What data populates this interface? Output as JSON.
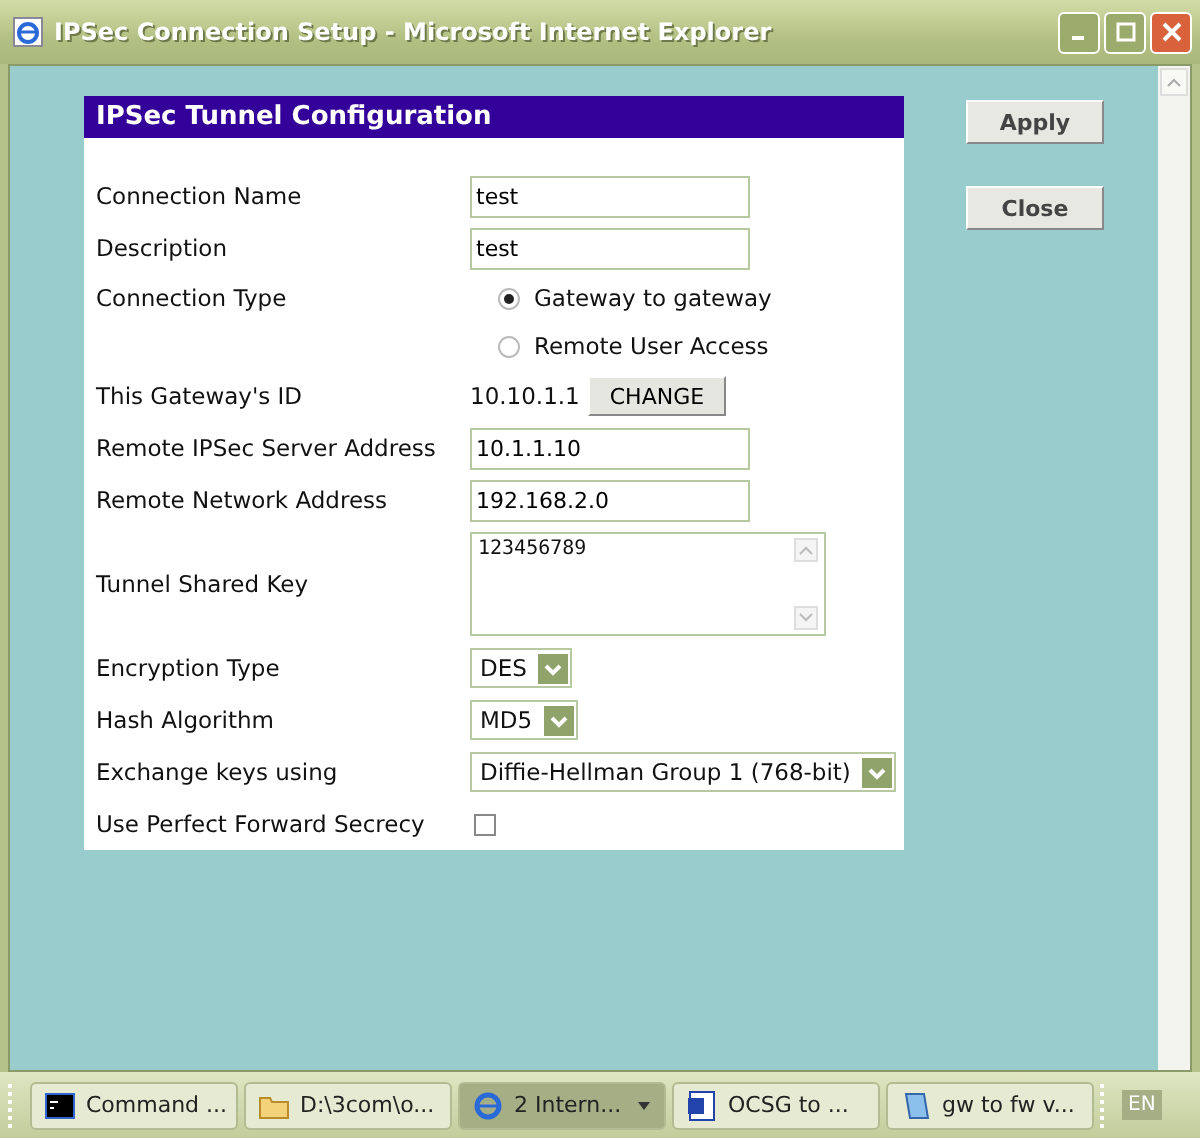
{
  "window": {
    "title": "IPSec Connection Setup - Microsoft Internet Explorer"
  },
  "panel": {
    "title": "IPSec Tunnel Configuration",
    "rows": [
      {
        "kind": "text",
        "label": "Connection Name",
        "value": "test"
      },
      {
        "kind": "text",
        "label": "Description",
        "value": "test"
      },
      {
        "kind": "radio",
        "label": "Connection Type",
        "options": [
          {
            "label": "Gateway to gateway",
            "selected": true
          },
          {
            "label": "Remote User Access",
            "selected": false
          }
        ]
      },
      {
        "kind": "id",
        "label": "This Gateway's ID",
        "value": "10.10.1.1",
        "button": "CHANGE"
      },
      {
        "kind": "text",
        "label": "Remote IPSec Server Address",
        "value": "10.1.1.10"
      },
      {
        "kind": "text",
        "label": "Remote Network Address",
        "value": "192.168.2.0"
      },
      {
        "kind": "textarea",
        "label": "Tunnel Shared Key",
        "value": "123456789"
      },
      {
        "kind": "select",
        "label": "Encryption Type",
        "value": "DES"
      },
      {
        "kind": "select",
        "label": "Hash Algorithm",
        "value": "MD5"
      },
      {
        "kind": "select",
        "label": "Exchange keys using",
        "value": "Diffie-Hellman Group 1 (768-bit)"
      },
      {
        "kind": "checkbox",
        "label": "Use Perfect Forward Secrecy",
        "checked": false
      }
    ]
  },
  "buttons": [
    "Apply",
    "Close"
  ],
  "taskbar": [
    {
      "kind": "console",
      "label": "Command ...",
      "selected": false
    },
    {
      "kind": "folder",
      "label": "D:\\3com\\o...",
      "selected": false
    },
    {
      "kind": "browser",
      "label": "2  Intern...",
      "selected": true
    },
    {
      "kind": "word",
      "label": "OCSG to ...",
      "selected": false
    },
    {
      "kind": "notepad",
      "label": "gw to fw v...",
      "selected": false
    }
  ],
  "language": "EN"
}
